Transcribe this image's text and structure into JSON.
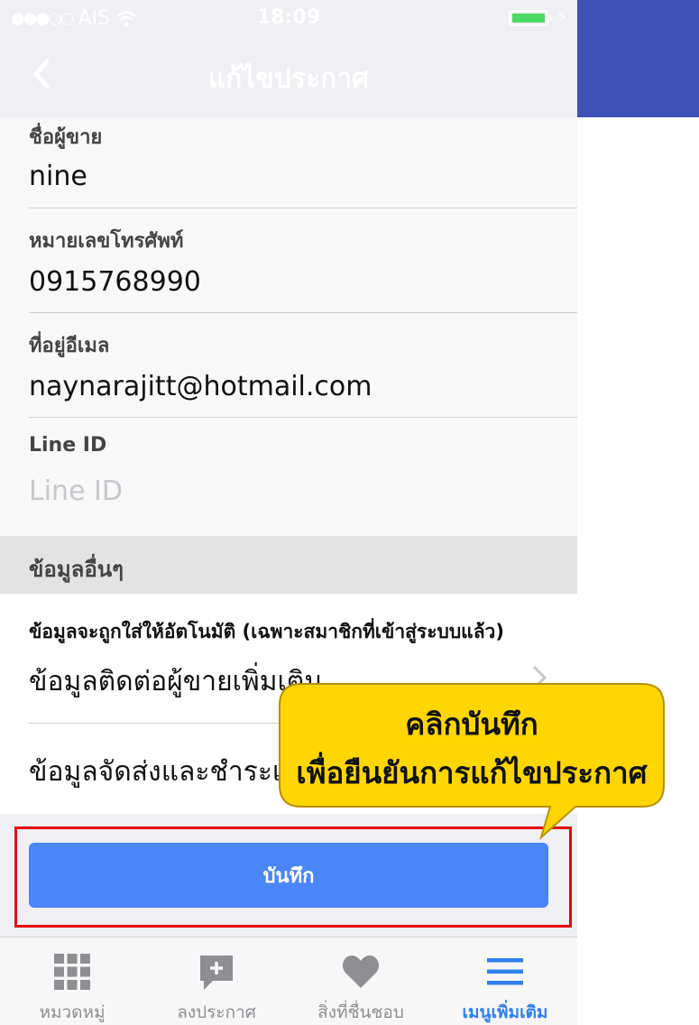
{
  "status": {
    "carrier": "AIS",
    "time": "18:09"
  },
  "nav": {
    "title": "แก้ไขประกาศ"
  },
  "fields": {
    "seller_name": {
      "label": "ชื่อผู้ขาย",
      "value": "nine"
    },
    "phone": {
      "label": "หมายเลขโทรศัพท์",
      "value": "0915768990"
    },
    "email": {
      "label": "ที่อยู่อีเมล",
      "value": "naynarajitt@hotmail.com"
    },
    "line_id": {
      "label": "Line ID",
      "placeholder": "Line ID"
    }
  },
  "other_info": {
    "heading": "ข้อมูลอื่นๆ",
    "auto_note": "ข้อมูลจะถูกใส่ให้อัตโนมัติ (เฉพาะสมาชิกที่เข้าสู่ระบบแล้ว)",
    "rows": [
      {
        "label": "ข้อมูลติดต่อผู้ขายเพิ่มเติม"
      },
      {
        "label": "ข้อมูลจัดส่งและชำระเงิน"
      }
    ]
  },
  "save_label": "บันทึก",
  "callout": {
    "line1": "คลิกบันทึก",
    "line2": "เพื่อยืนยันการแก้ไขประกาศ",
    "color": "#ffd600"
  },
  "tabs": [
    {
      "label": "หมวดหมู่",
      "icon": "grid-icon"
    },
    {
      "label": "ลงประกาศ",
      "icon": "add-post-icon"
    },
    {
      "label": "สิ่งที่ชื่นชอบ",
      "icon": "heart-icon"
    },
    {
      "label": "เมนูเพิ่มเติม",
      "icon": "menu-icon",
      "active": true
    }
  ],
  "colors": {
    "header": "#3f51b5",
    "button": "#4a86f7",
    "highlight": "#e60012",
    "active_tab": "#2f80ed"
  }
}
